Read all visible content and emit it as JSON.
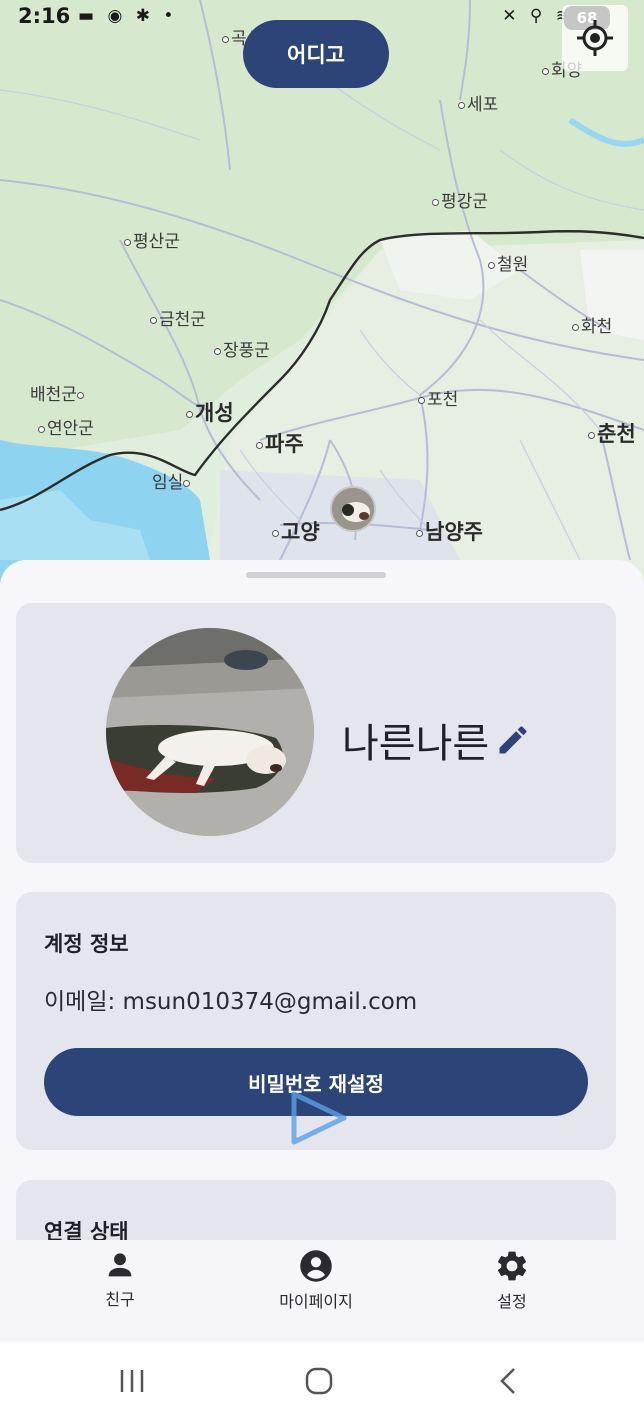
{
  "status_bar": {
    "time": "2:16",
    "left_icons": [
      "chat-icon",
      "camera-icon",
      "signal-icon"
    ],
    "right_icons": [
      "mute-icon",
      "location-icon",
      "wifi-icon",
      "signal-bars-icon"
    ],
    "battery": "68"
  },
  "map": {
    "title_button": "어디고",
    "labels": {
      "l1": "세포",
      "l2": "평강군",
      "l3": "평산군",
      "l4": "철원",
      "l5": "금천군",
      "l6": "화천",
      "l7": "장풍군",
      "l8": "배천군",
      "l9": "연안군",
      "l10": "개성",
      "l11": "포천",
      "l12": "파주",
      "l13": "춘천",
      "l14": "임실",
      "l15": "고양",
      "l16": "남양주",
      "l17": "회양",
      "l18": "곡산"
    }
  },
  "profile": {
    "username": "나른나른"
  },
  "account": {
    "title": "계정 정보",
    "email": "이메일: msun010374@gmail.com",
    "reset_button": "비밀번호 재설정"
  },
  "connection": {
    "title": "연결 상태"
  },
  "bottom_nav": {
    "friends": "친구",
    "mypage": "마이페이지",
    "settings": "설정"
  },
  "colors": {
    "primary": "#2d4478",
    "card": "#e5e5ee",
    "sheet": "#f6f6fb"
  }
}
